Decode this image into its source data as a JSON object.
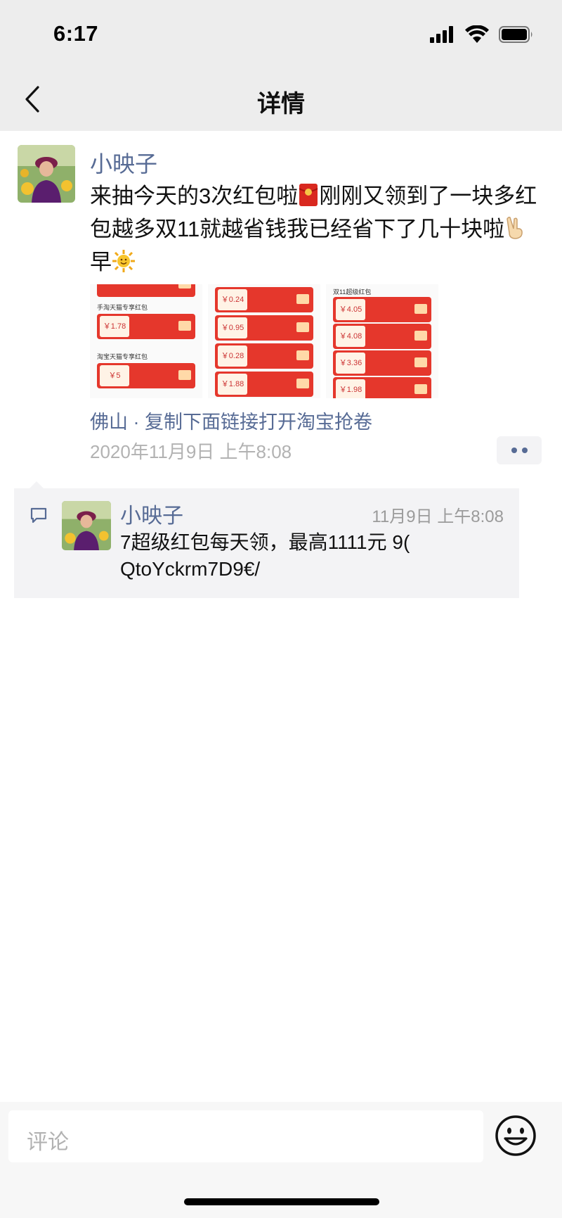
{
  "status_bar": {
    "time": "6:17"
  },
  "nav": {
    "title": "详情"
  },
  "post": {
    "author": "小映子",
    "text": "来抽今天的3次红包啦",
    "text_after_packet": "刚刚又领到了一块多红包越多双11就越省钱我已经省下了几十块啦",
    "text_after_victory": "早",
    "photos": [
      {
        "labels": [
          "手淘天猫专享红包",
          "淘宝天猫专享红包"
        ],
        "amounts": [
          "￥1.78",
          "￥5"
        ]
      },
      {
        "labels": [],
        "amounts": [
          "￥0.24",
          "￥0.95",
          "￥0.28",
          "￥1.88"
        ]
      },
      {
        "labels": [
          "双11超级红包"
        ],
        "amounts": [
          "￥4.05",
          "￥4.08",
          "￥3.36",
          "￥1.98"
        ]
      }
    ],
    "location": "佛山 · 复制下面链接打开淘宝抢卷",
    "time": "2020年11月9日 上午8:08"
  },
  "comment": {
    "author": "小映子",
    "time": "11月9日 上午8:08",
    "text": "7超级红包每天领，最高1111元 9( QtoYckrm7D9€/"
  },
  "input": {
    "placeholder": "评论"
  },
  "colors": {
    "link": "#576b95",
    "nav_bg": "#ededed",
    "comment_bg": "#f3f3f5"
  }
}
